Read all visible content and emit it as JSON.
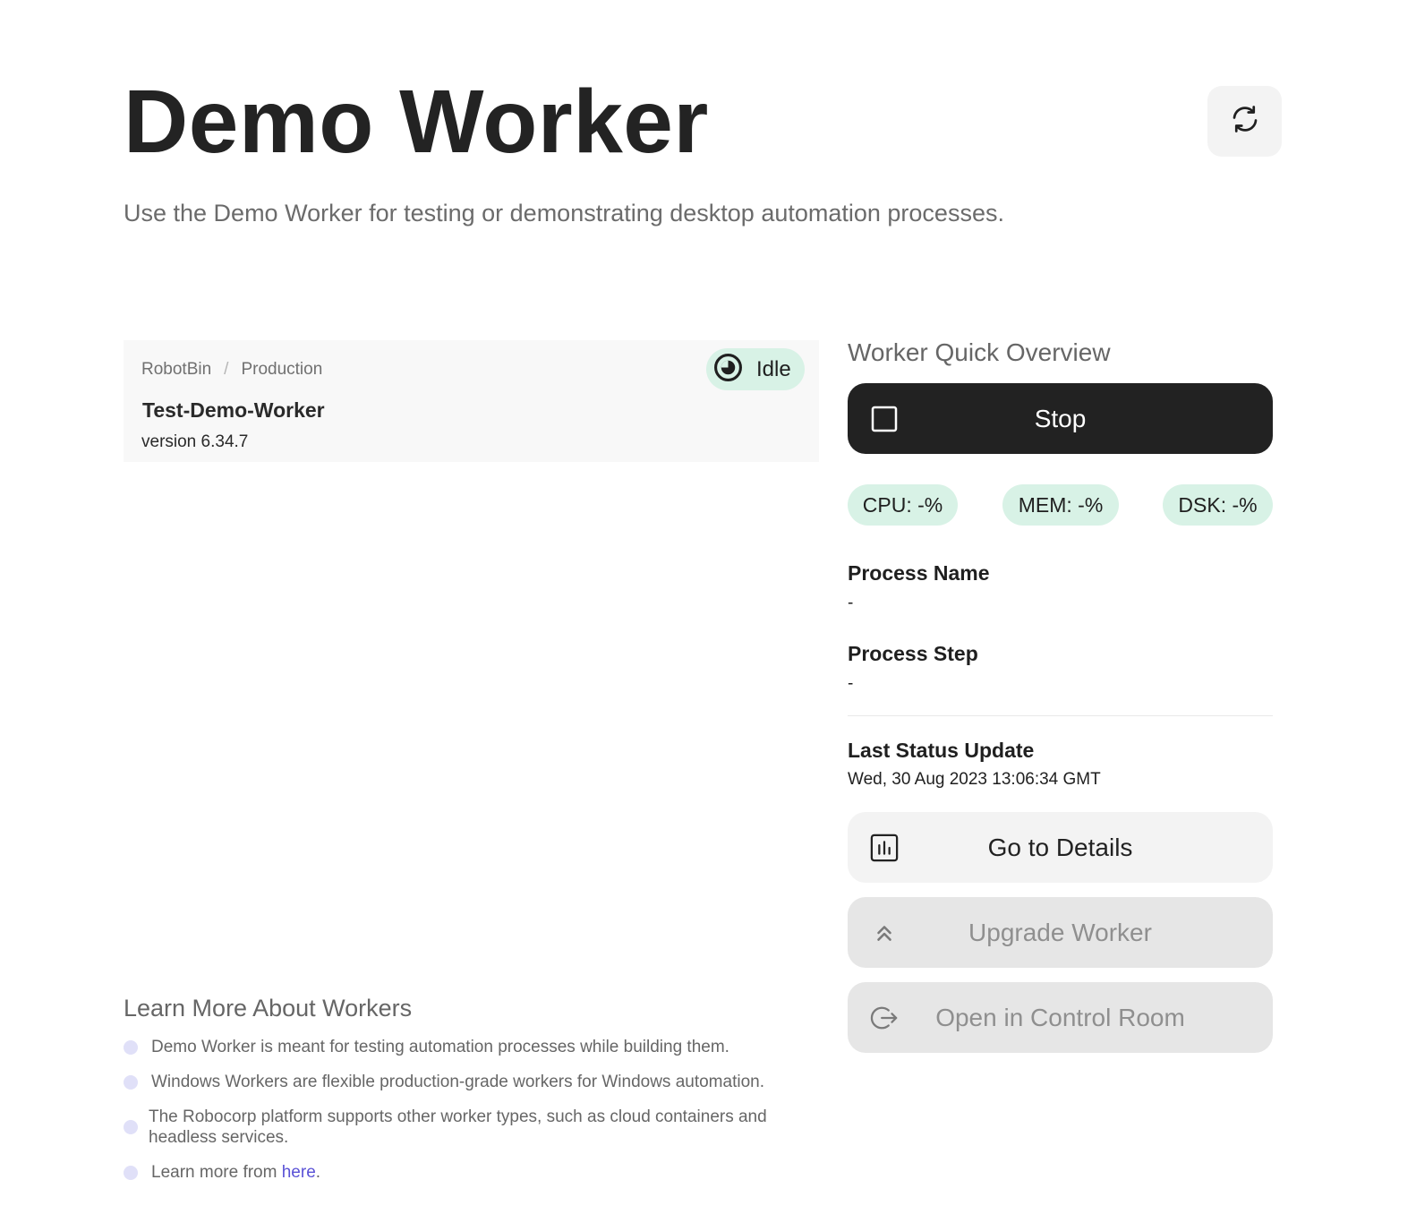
{
  "header": {
    "title": "Demo Worker",
    "subtitle": "Use the Demo Worker for testing or demonstrating desktop automation processes."
  },
  "worker": {
    "breadcrumb": [
      "RobotBin",
      "Production"
    ],
    "breadcrumb_separator": "/",
    "name": "Test-Demo-Worker",
    "version": "version 6.34.7",
    "status": "Idle"
  },
  "overview": {
    "title": "Worker Quick Overview",
    "stop_label": "Stop",
    "stats": {
      "cpu": "CPU: -%",
      "mem": "MEM: -%",
      "dsk": "DSK: -%"
    },
    "process_name_label": "Process Name",
    "process_name_value": "-",
    "process_step_label": "Process Step",
    "process_step_value": "-",
    "last_update_label": "Last Status Update",
    "last_update_value": "Wed, 30 Aug 2023 13:06:34 GMT",
    "details_label": "Go to Details",
    "upgrade_label": "Upgrade Worker",
    "control_room_label": "Open in Control Room"
  },
  "learn": {
    "title": "Learn More About Workers",
    "items": [
      "Demo Worker is meant for testing automation processes while building them.",
      "Windows Workers are flexible production-grade workers for Windows automation.",
      "The Robocorp platform supports other worker types, such as cloud containers and headless services."
    ],
    "last_item_prefix": "Learn more from ",
    "last_item_link": "here",
    "last_item_suffix": "."
  },
  "colors": {
    "accent_dark": "#222222",
    "status_green_bg": "#d8f2e6",
    "link": "#5a52d6"
  },
  "icons": {
    "refresh": "refresh-icon",
    "status": "idle-status-icon",
    "stop": "stop-square-icon",
    "details": "chart-icon",
    "upgrade": "double-chevron-up-icon",
    "control_room": "exit-arrow-icon"
  }
}
